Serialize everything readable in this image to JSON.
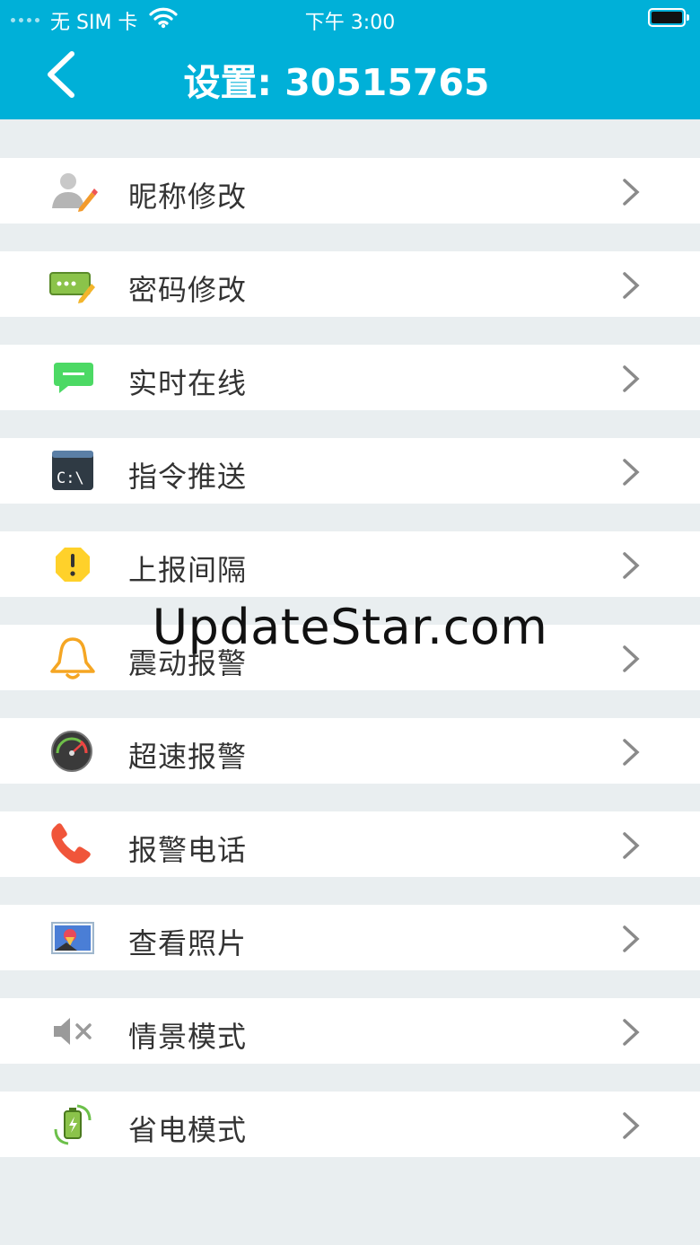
{
  "status_bar": {
    "carrier": "无 SIM 卡",
    "time": "下午 3:00"
  },
  "nav": {
    "title": "设置: 30515765"
  },
  "colors": {
    "accent": "#00b0d8",
    "background": "#e9eef0",
    "row": "#ffffff",
    "text": "#333333",
    "chevron": "#8a8a8a"
  },
  "items": [
    {
      "label": "昵称修改",
      "icon": "user-edit-icon"
    },
    {
      "label": "密码修改",
      "icon": "password-icon"
    },
    {
      "label": "实时在线",
      "icon": "chat-bubble-icon"
    },
    {
      "label": "指令推送",
      "icon": "terminal-icon"
    },
    {
      "label": "上报间隔",
      "icon": "warning-icon"
    },
    {
      "label": "震动报警",
      "icon": "bell-icon"
    },
    {
      "label": "超速报警",
      "icon": "speedometer-icon"
    },
    {
      "label": "报警电话",
      "icon": "phone-icon"
    },
    {
      "label": "查看照片",
      "icon": "photo-icon"
    },
    {
      "label": "情景模式",
      "icon": "mute-icon"
    },
    {
      "label": "省电模式",
      "icon": "power-save-icon"
    }
  ],
  "watermark": "UpdateStar.com"
}
